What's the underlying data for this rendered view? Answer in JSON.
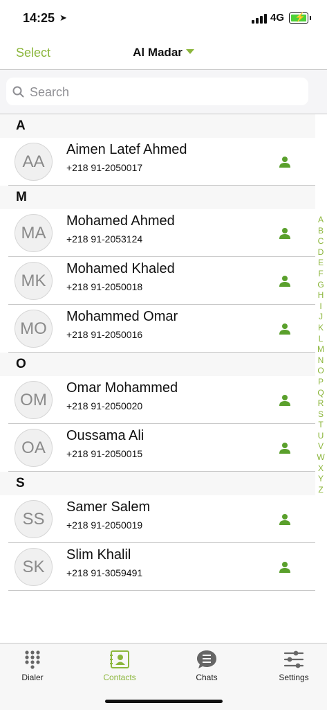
{
  "status": {
    "time": "14:25",
    "network": "4G"
  },
  "nav": {
    "select_label": "Select",
    "title": "Al Madar"
  },
  "search": {
    "placeholder": "Search"
  },
  "sections": [
    {
      "letter": "A",
      "contacts": [
        {
          "initials": "AA",
          "name": "Aimen Latef Ahmed",
          "phone": "+218 91-2050017"
        }
      ]
    },
    {
      "letter": "M",
      "contacts": [
        {
          "initials": "MA",
          "name": "Mohamed Ahmed",
          "phone": "+218 91-2053124"
        },
        {
          "initials": "MK",
          "name": "Mohamed Khaled",
          "phone": "+218 91-2050018"
        },
        {
          "initials": "MO",
          "name": "Mohammed Omar",
          "phone": "+218 91-2050016"
        }
      ]
    },
    {
      "letter": "O",
      "contacts": [
        {
          "initials": "OM",
          "name": "Omar Mohammed",
          "phone": "+218 91-2050020"
        },
        {
          "initials": "OA",
          "name": "Oussama Ali",
          "phone": "+218 91-2050015"
        }
      ]
    },
    {
      "letter": "S",
      "contacts": [
        {
          "initials": "SS",
          "name": "Samer Salem",
          "phone": "+218 91-2050019"
        },
        {
          "initials": "SK",
          "name": "Slim Khalil",
          "phone": "+218 91-3059491"
        }
      ]
    }
  ],
  "index_letters": [
    "A",
    "B",
    "C",
    "D",
    "E",
    "F",
    "G",
    "H",
    "I",
    "J",
    "K",
    "L",
    "M",
    "N",
    "O",
    "P",
    "Q",
    "R",
    "S",
    "T",
    "U",
    "V",
    "W",
    "X",
    "Y",
    "Z"
  ],
  "tabs": [
    {
      "label": "Dialer",
      "icon": "dialpad-icon"
    },
    {
      "label": "Contacts",
      "icon": "contacts-book-icon"
    },
    {
      "label": "Chats",
      "icon": "chat-bubble-icon"
    },
    {
      "label": "Settings",
      "icon": "sliders-icon"
    }
  ],
  "colors": {
    "accent": "#8cb63c",
    "presence": "#5aa02c",
    "battery": "#4cd137"
  }
}
